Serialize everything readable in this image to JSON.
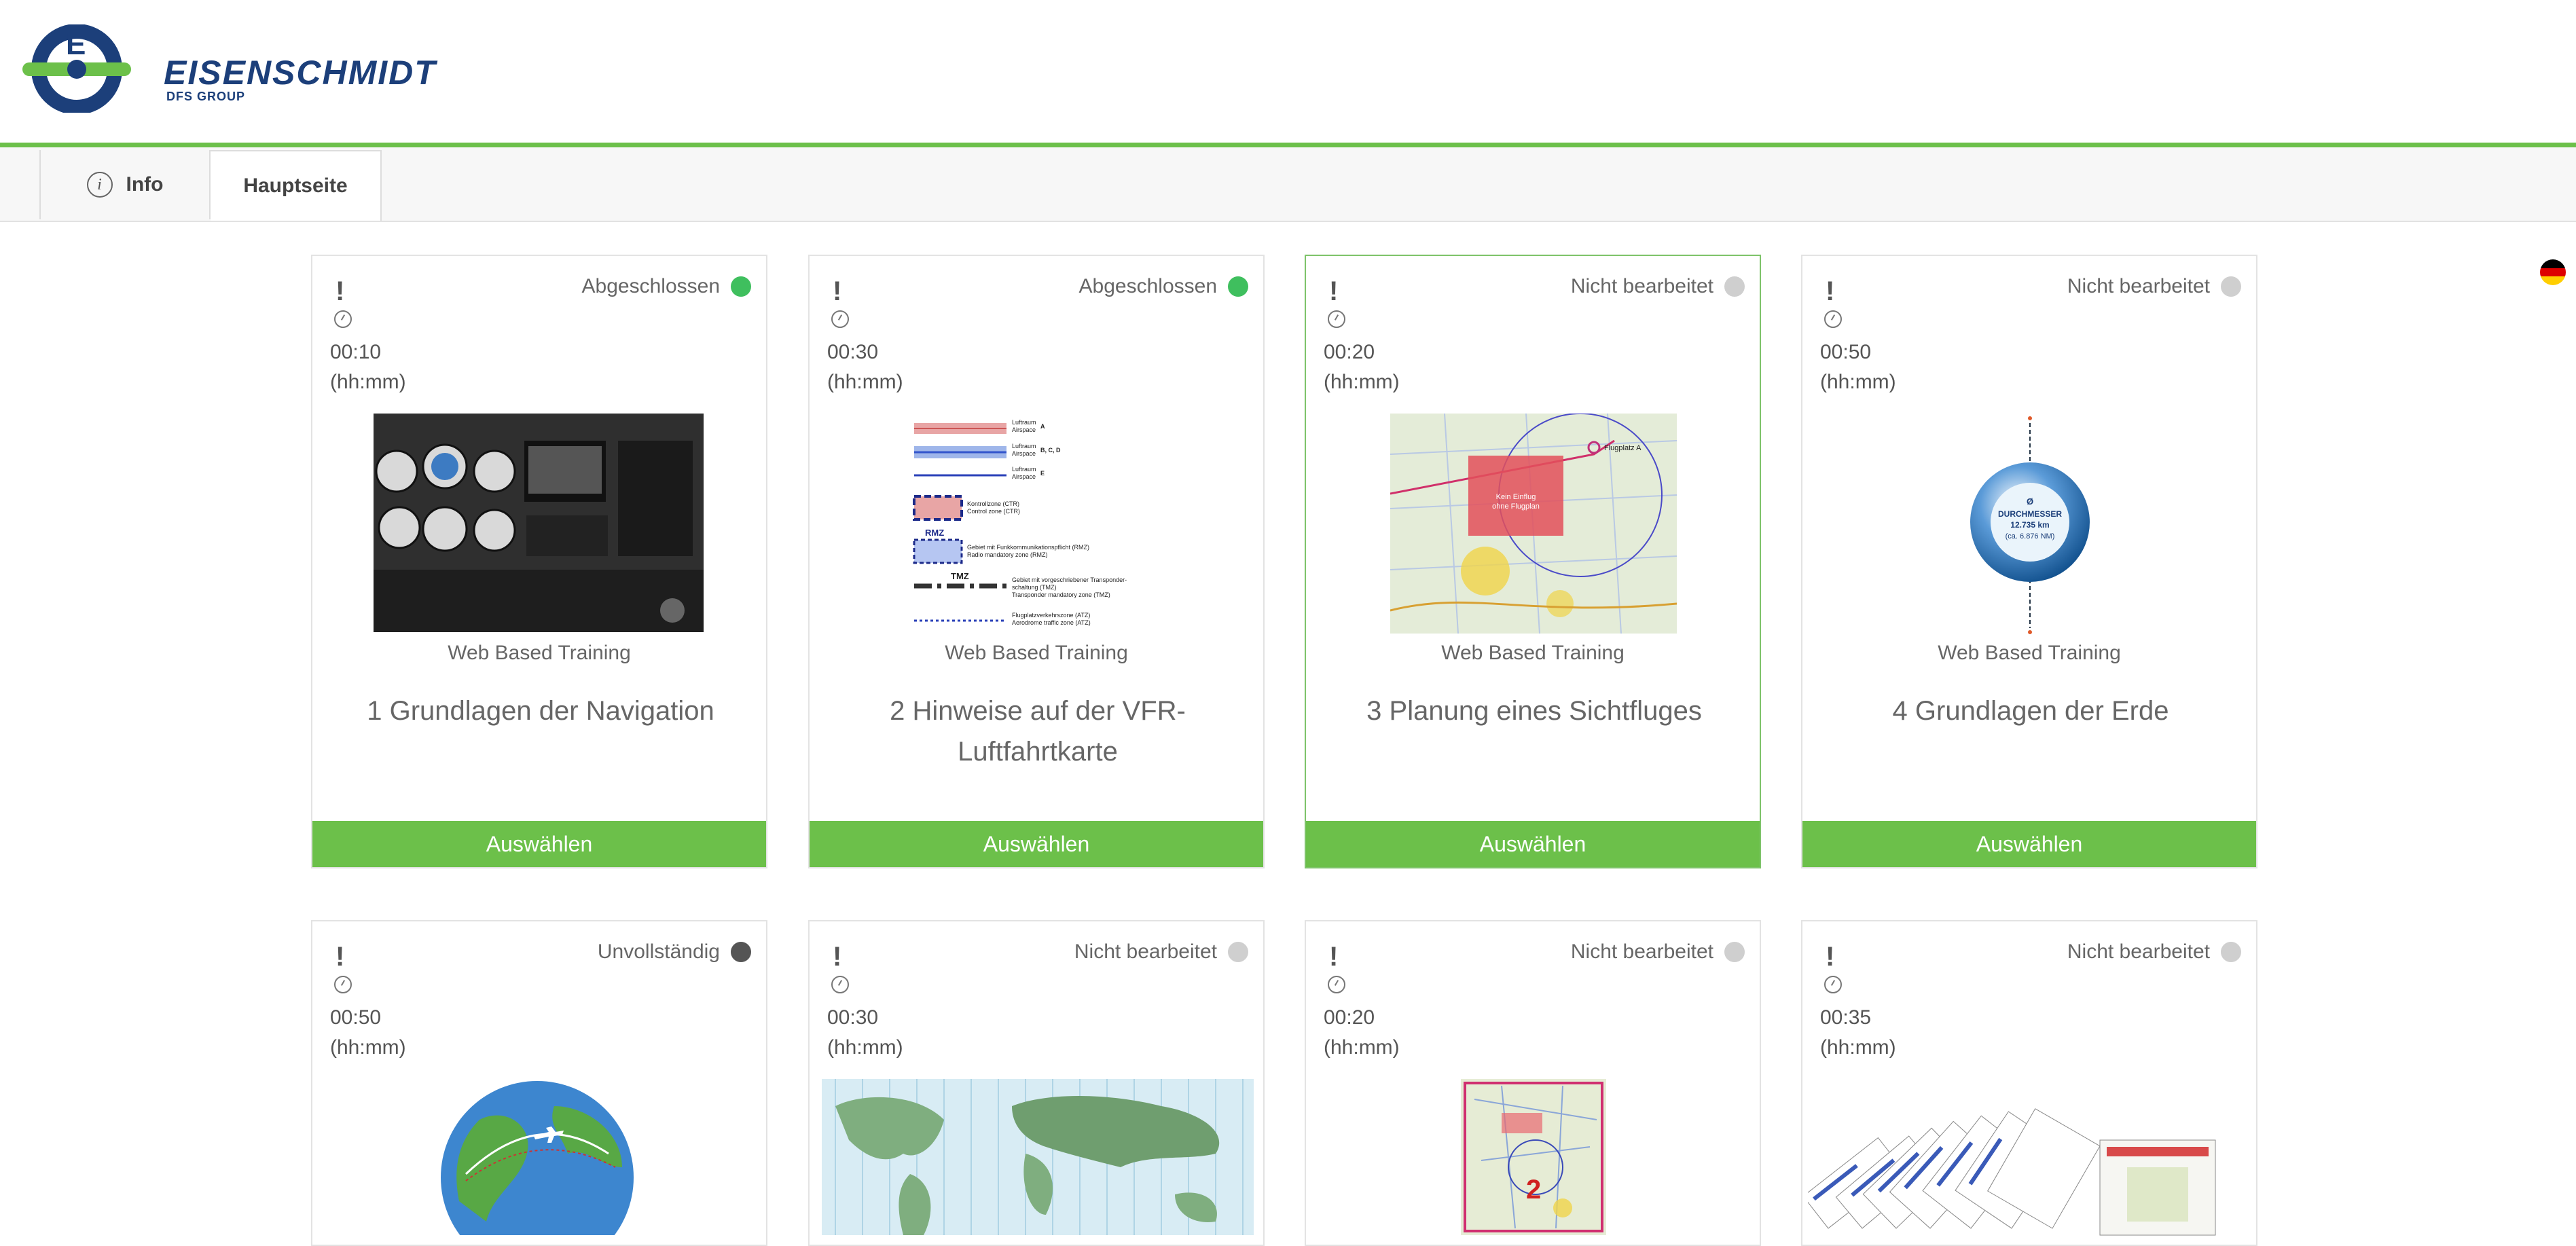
{
  "brand": {
    "name": "EISENSCHMIDT",
    "sub": "DFS GROUP"
  },
  "tabs": [
    {
      "label": "Info"
    },
    {
      "label": "Hauptseite"
    }
  ],
  "colors": {
    "accent": "#6cc04a",
    "done": "#3fbf5e",
    "open": "#cfcfcf",
    "incomplete": "#555555"
  },
  "cards": [
    {
      "status": "Abgeschlossen",
      "time": "00:10",
      "unit": "(hh:mm)",
      "type": "Web Based Training",
      "title": "1 Grundlagen der Navigation",
      "button": "Auswählen"
    },
    {
      "status": "Abgeschlossen",
      "time": "00:30",
      "unit": "(hh:mm)",
      "type": "Web Based Training",
      "title": "2 Hinweise auf der VFR-Luftfahrtkarte",
      "button": "Auswählen"
    },
    {
      "status": "Nicht bearbeitet",
      "time": "00:20",
      "unit": "(hh:mm)",
      "type": "Web Based Training",
      "title": "3 Planung eines Sichtfluges",
      "button": "Auswählen"
    },
    {
      "status": "Nicht bearbeitet",
      "time": "00:50",
      "unit": "(hh:mm)",
      "type": "Web Based Training",
      "title": "4 Grundlagen der Erde",
      "button": "Auswählen"
    },
    {
      "status": "Unvollständig",
      "time": "00:50",
      "unit": "(hh:mm)"
    },
    {
      "status": "Nicht bearbeitet",
      "time": "00:30",
      "unit": "(hh:mm)"
    },
    {
      "status": "Nicht bearbeitet",
      "time": "00:20",
      "unit": "(hh:mm)"
    },
    {
      "status": "Nicht bearbeitet",
      "time": "00:35",
      "unit": "(hh:mm)"
    }
  ],
  "legend": {
    "l1a": "Luftraum",
    "l1b": "Airspace",
    "l1c": "A",
    "l2a": "Luftraum",
    "l2b": "Airspace",
    "l2c": "B, C, D",
    "l3a": "Luftraum",
    "l3b": "Airspace",
    "l3c": "E",
    "ctr1": "Kontrollzone (CTR)",
    "ctr2": "Control zone (CTR)",
    "rmz": "RMZ",
    "rmz1": "Gebiet mit Funkkommunikationspflicht (RMZ)",
    "rmz2": "Radio mandatory zone (RMZ)",
    "tmz": "TMZ",
    "tmz1": "Gebiet mit vorgeschriebener Transponder-",
    "tmz2": "schaltung (TMZ)",
    "tmz3": "Transponder mandatory zone (TMZ)",
    "atz1": "Flugplatzverkehrszone (ATZ)",
    "atz2": "Aerodrome traffic zone (ATZ)"
  },
  "map_label": {
    "l1": "Kein Einflug",
    "l2": "ohne Flugplan",
    "place": "Flugplatz A"
  },
  "earth": {
    "sym": "Ø",
    "l1": "DURCHMESSER",
    "l2": "12.735 km",
    "l3": "(ca. 6.876 NM)"
  }
}
